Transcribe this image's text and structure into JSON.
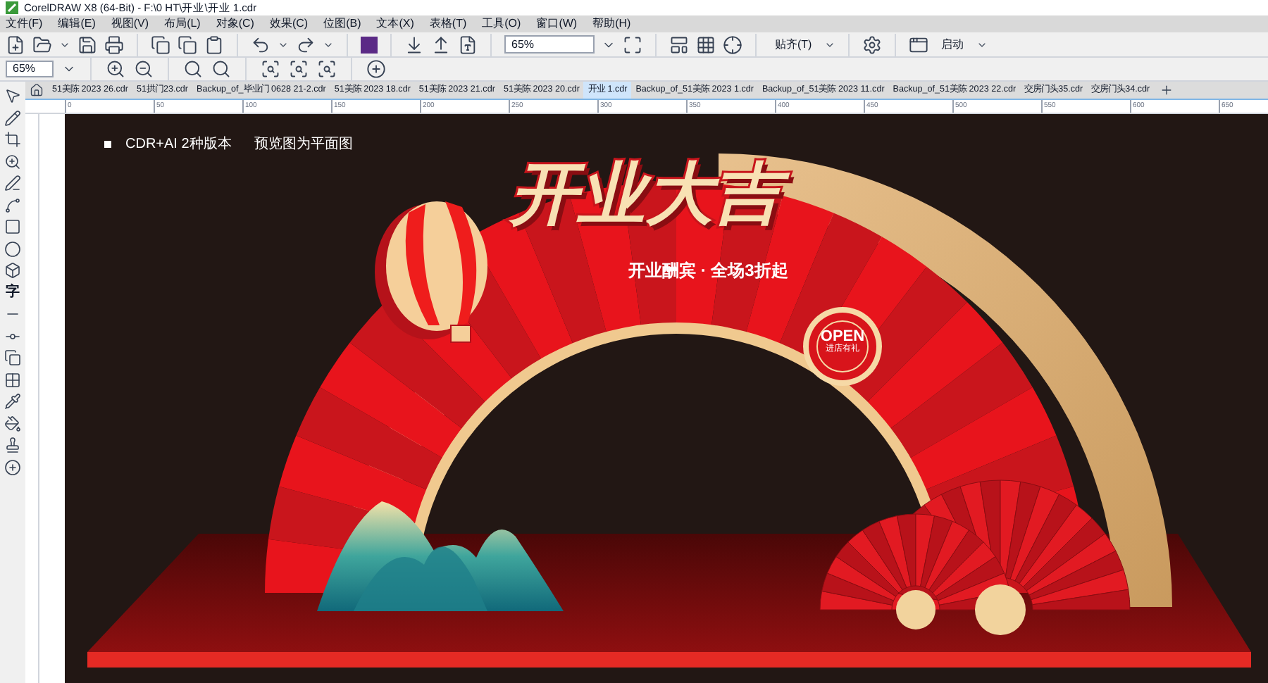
{
  "window": {
    "title": "CorelDRAW X8 (64-Bit) - F:\\0 HT\\开业\\开业 1.cdr"
  },
  "menu": [
    "文件(F)",
    "编辑(E)",
    "视图(V)",
    "布局(L)",
    "对象(C)",
    "效果(C)",
    "位图(B)",
    "文本(X)",
    "表格(T)",
    "工具(O)",
    "窗口(W)",
    "帮助(H)"
  ],
  "toolbar": {
    "zoom": "65%",
    "snap": "贴齐(T)",
    "launch": "启动"
  },
  "zoom_toolbar": {
    "zoom": "65%"
  },
  "toolbox": {
    "text_tool": "字"
  },
  "tabs": [
    {
      "label": "51美陈 2023 26.cdr",
      "selected": false
    },
    {
      "label": "51拱门23.cdr",
      "selected": false
    },
    {
      "label": "Backup_of_毕业门 0628 21-2.cdr",
      "selected": false
    },
    {
      "label": "51美陈 2023 18.cdr",
      "selected": false
    },
    {
      "label": "51美陈 2023 21.cdr",
      "selected": false
    },
    {
      "label": "51美陈 2023 20.cdr",
      "selected": false
    },
    {
      "label": "开业 1.cdr",
      "selected": true
    },
    {
      "label": "Backup_of_51美陈 2023 1.cdr",
      "selected": false
    },
    {
      "label": "Backup_of_51美陈 2023 11.cdr",
      "selected": false
    },
    {
      "label": "Backup_of_51美陈 2023 22.cdr",
      "selected": false
    },
    {
      "label": "交房门头35.cdr",
      "selected": false
    },
    {
      "label": "交房门头34.cdr",
      "selected": false
    }
  ],
  "ruler": {
    "labels": [
      "0",
      "50",
      "100",
      "150",
      "200",
      "250",
      "300",
      "350",
      "400",
      "450",
      "500",
      "550",
      "600",
      "650"
    ]
  },
  "artwork": {
    "note": "CDR+AI 2种版本",
    "note_2": "预览图为平面图",
    "headline": "开业大吉",
    "subline": "开业酬宾 · 全场3折起",
    "badge": "OPEN",
    "badge_sub": "进店有礼"
  }
}
